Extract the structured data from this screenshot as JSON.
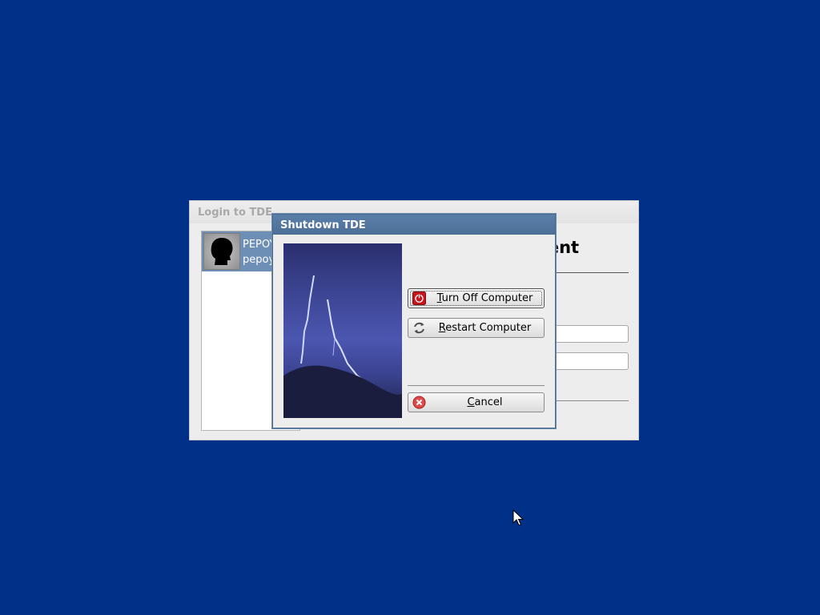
{
  "login_window": {
    "title": "Login to TDE",
    "greeting_fragment": "nment",
    "user": {
      "name_fragment": "PEPOY",
      "login_fragment": "pepoy"
    },
    "avatar_icon": "user-silhouette-icon"
  },
  "shutdown_dialog": {
    "title": "Shutdown TDE",
    "image": "lightning-storm-image",
    "buttons": {
      "turn_off": {
        "mnemonic": "T",
        "rest": "urn Off Computer",
        "icon": "power-icon"
      },
      "restart": {
        "mnemonic": "R",
        "rest": "estart Computer",
        "icon": "restart-icon"
      },
      "cancel": {
        "mnemonic": "C",
        "rest": "ancel",
        "icon": "cancel-icon"
      }
    }
  },
  "colors": {
    "desktop_background": "#003087",
    "dialog_titlebar": "#4c6f97",
    "selected_user": "#6d8fb5"
  }
}
